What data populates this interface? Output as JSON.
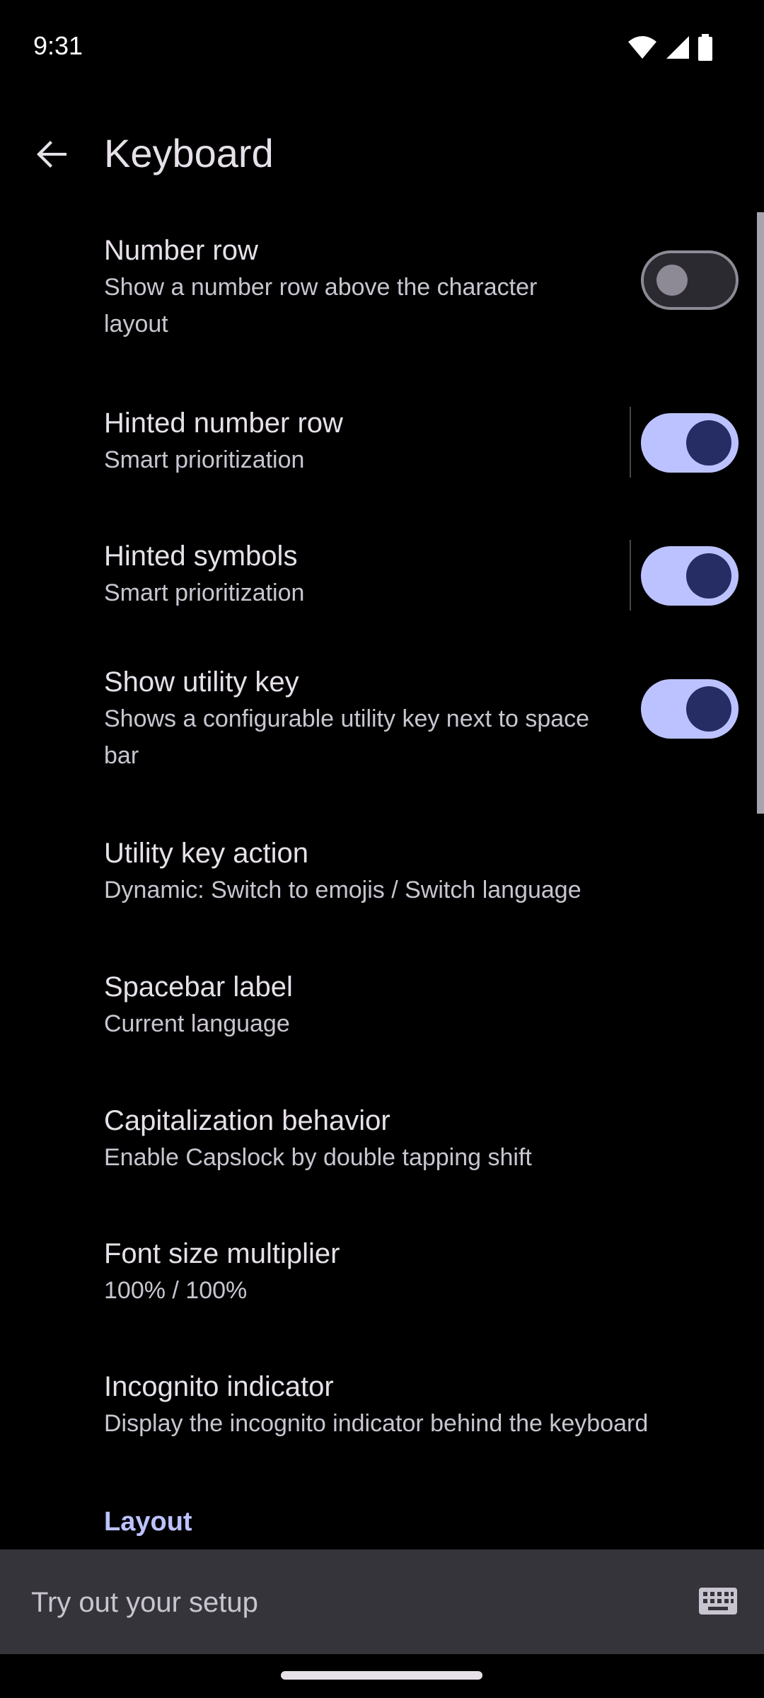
{
  "status_bar": {
    "time": "9:31",
    "icons": [
      "wifi-icon",
      "signal-icon",
      "battery-icon"
    ]
  },
  "app_bar": {
    "back_icon": "arrow-back-icon",
    "title": "Keyboard"
  },
  "preferences": [
    {
      "title": "Number row",
      "summary": "Show a number row above the character layout",
      "switch": "off"
    },
    {
      "title": "Hinted number row",
      "summary": "Smart prioritization",
      "switch": "on",
      "divider": true
    },
    {
      "title": "Hinted symbols",
      "summary": "Smart prioritization",
      "switch": "on",
      "divider": true
    },
    {
      "title": "Show utility key",
      "summary": "Shows a configurable utility key next to space bar",
      "switch": "on"
    },
    {
      "title": "Utility key action",
      "summary": "Dynamic: Switch to emojis / Switch language"
    },
    {
      "title": "Spacebar label",
      "summary": "Current language"
    },
    {
      "title": "Capitalization behavior",
      "summary": "Enable Capslock by double tapping shift"
    },
    {
      "title": "Font size multiplier",
      "summary": "100% / 100%"
    },
    {
      "title": "Incognito indicator",
      "summary": "Display the incognito indicator behind the keyboard"
    }
  ],
  "section": {
    "layout_header": "Layout"
  },
  "try_bar": {
    "placeholder": "Try out your setup",
    "icon": "keyboard-icon"
  },
  "colors": {
    "background": "#000000",
    "accent": "#bcc2ff",
    "switch_thumb_on": "#252d64",
    "try_bar": "#35343a"
  }
}
